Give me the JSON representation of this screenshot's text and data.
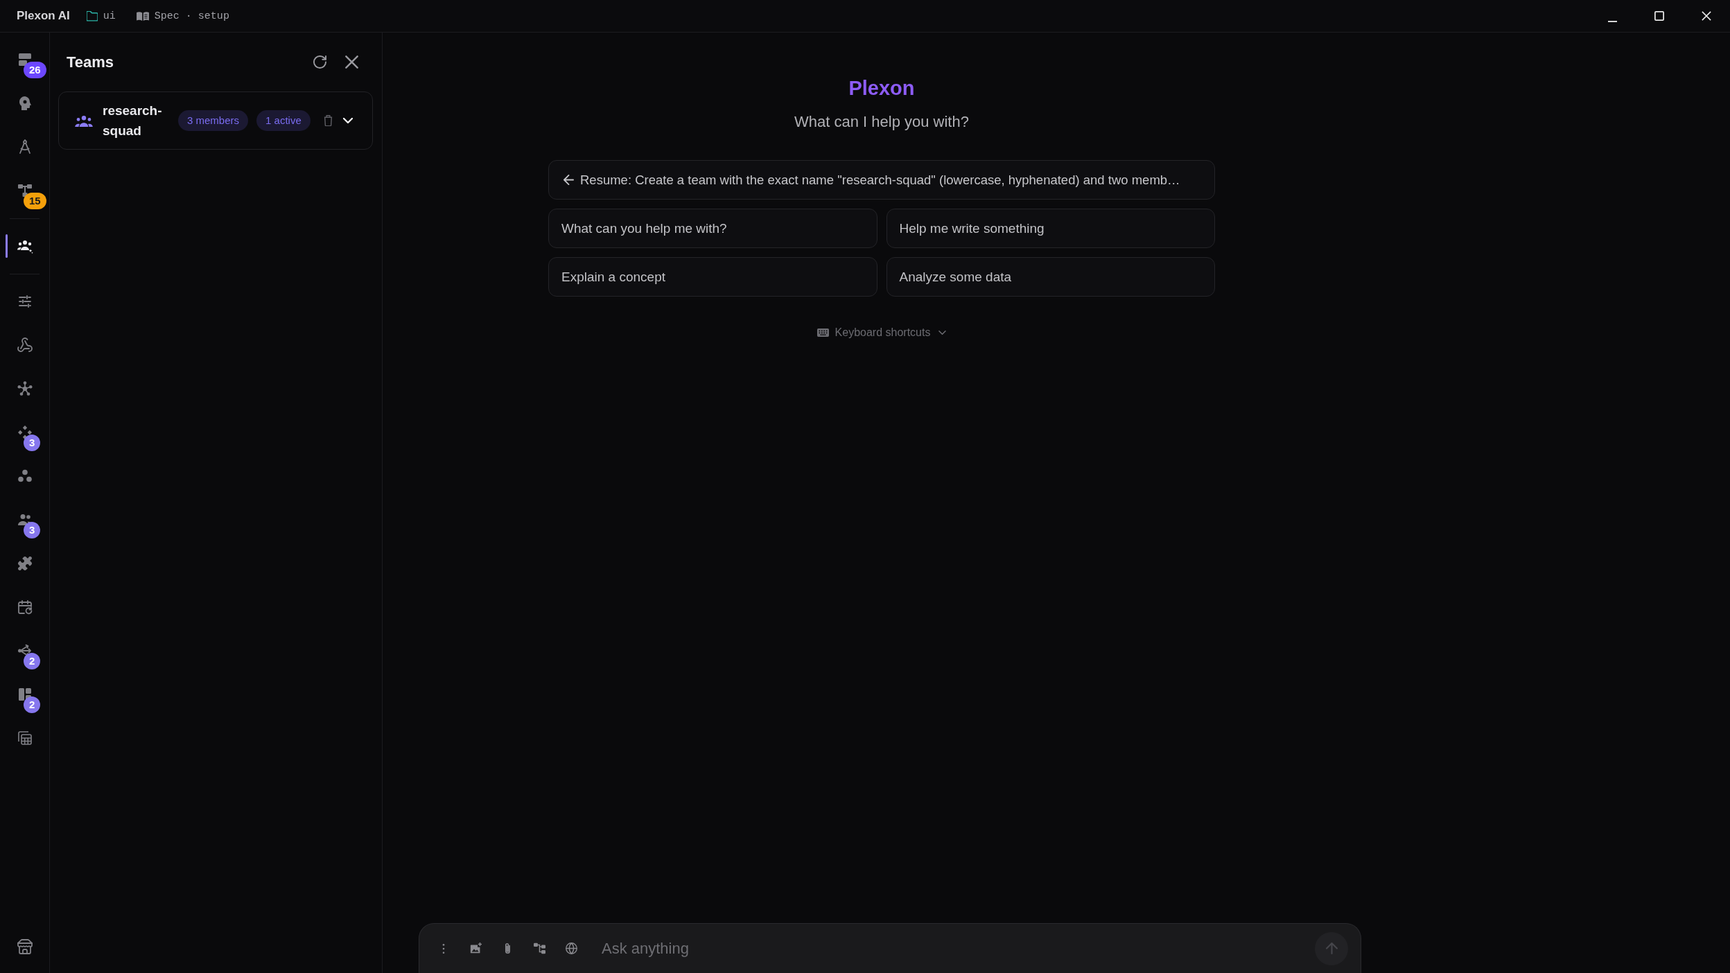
{
  "title_bar": {
    "app_name": "Plexon AI",
    "folder": "ui",
    "document": "Spec · setup"
  },
  "rail": {
    "groups": [
      {
        "items": [
          {
            "selected": false,
            "badge": "26",
            "color": "#6c47ff"
          },
          {
            "selected": false
          },
          {
            "selected": false
          },
          {
            "selected": false,
            "badge": "15",
            "color": "#f5a00b"
          }
        ]
      },
      {
        "items": [
          {
            "selected": true
          }
        ]
      },
      {
        "items": [
          {
            "selected": false
          },
          {
            "selected": false
          },
          {
            "selected": false
          },
          {
            "selected": false,
            "badge": "3",
            "color": "#8677ee"
          },
          {
            "selected": false
          },
          {
            "selected": false,
            "badge": "3",
            "color": "#8677ee"
          },
          {
            "selected": false
          },
          {
            "selected": false
          },
          {
            "selected": false,
            "badge": "2",
            "color": "#8677ee"
          },
          {
            "selected": false,
            "badge": "2",
            "color": "#8677ee"
          },
          {
            "selected": false
          }
        ]
      }
    ],
    "footer": {
      "items": [
        {
          "selected": false
        }
      ]
    }
  },
  "teams_panel": {
    "title": "Teams",
    "teams": [
      {
        "name": "research-squad",
        "members": "3 members",
        "active": "1 active",
        "expanded": false
      }
    ]
  },
  "main": {
    "brand": "Plexon",
    "greeting": "What can I help you with?",
    "resume": {
      "label": "Resume: Create a team with the exact name \"research-squad\" (lowercase, hyphenated) and two memb…"
    },
    "suggestions": [
      "What can you help me with?",
      "Help me write something",
      "Explain a concept",
      "Analyze some data"
    ],
    "shortcuts": {
      "label": "Keyboard shortcuts",
      "expanded": false
    }
  },
  "composer": {
    "placeholder": "Ask anything",
    "send_disabled": true
  }
}
